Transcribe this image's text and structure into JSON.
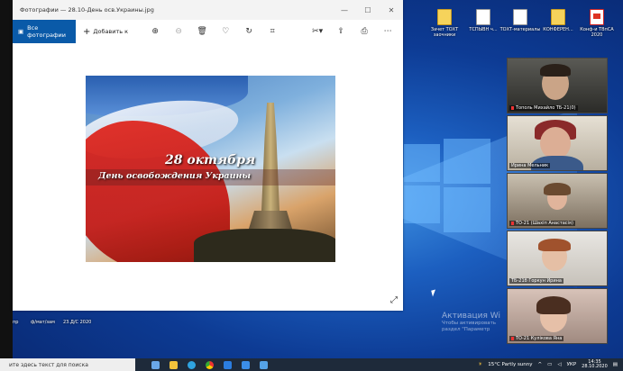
{
  "photos_window": {
    "title": "Фотографии — 28.10-День осв.Украины.jpg",
    "window_buttons": [
      "—",
      "☐",
      "✕"
    ],
    "toolbar": {
      "all_photos_label": "Все фотографии",
      "add_label": "Добавить к",
      "icons": [
        "zoom-in-icon",
        "zoom-out-icon",
        "delete-icon",
        "favorite-icon",
        "rotate-icon",
        "crop-icon",
        "edit-icon",
        "share-icon",
        "print-icon",
        "more-icon"
      ]
    },
    "image": {
      "date_text": "28 октября",
      "caption": "День освобождения Украины"
    }
  },
  "desktop_icons": [
    {
      "label": "Зачет ТОХТ заочники",
      "kind": "folder"
    },
    {
      "label": "ТСПЫВН ч...",
      "kind": "doc"
    },
    {
      "label": "ТОХТ-материалы",
      "kind": "doc"
    },
    {
      "label": "КОНФЕРЕН...",
      "kind": "folder"
    },
    {
      "label": "Конф-и ТВпСА 2020",
      "kind": "pdf"
    }
  ],
  "desktop_left_labels": [
    "пр",
    "ф/мат/зам",
    "23.Д/С 2020"
  ],
  "zoom": {
    "participants": [
      {
        "name": "Тополь Михайло ТБ-21(0)"
      },
      {
        "name": "Ирина Мельник"
      },
      {
        "name": "ТО-21 (Шахіп Анастасія)"
      },
      {
        "name": "ТБ-21б Горкун Ирина"
      },
      {
        "name": "ТО-21 Кулікова Яна"
      }
    ]
  },
  "activation": {
    "title": "Активация Wi",
    "line1": "Чтобы активировать",
    "line2": "раздел \"Параметр"
  },
  "taskbar": {
    "search_placeholder": "ите здесь текст для поиска",
    "weather": "15°C Partly sunny",
    "lang": "УКР",
    "time": "14:35",
    "date": "28.10.2020"
  }
}
